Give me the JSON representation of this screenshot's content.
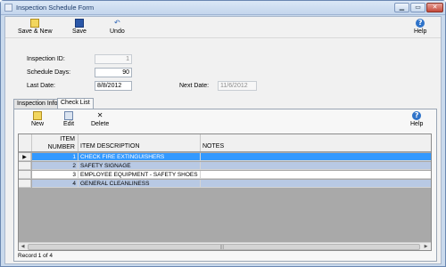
{
  "window": {
    "title": "Inspection Schedule Form",
    "controls": [
      "▁",
      "▭",
      "✕"
    ]
  },
  "toolbar": {
    "save_new": "Save & New",
    "save": "Save",
    "undo": "Undo",
    "help": "Help"
  },
  "form": {
    "inspection_id_label": "Inspection ID:",
    "inspection_id_value": "1",
    "schedule_days_label": "Schedule Days:",
    "schedule_days_value": "90",
    "last_date_label": "Last Date:",
    "last_date_value": "8/8/2012",
    "next_date_label": "Next Date:",
    "next_date_value": "11/6/2012"
  },
  "tabs": [
    "Inspection Info.",
    "Check List"
  ],
  "checklist": {
    "toolbar": {
      "new": "New",
      "edit": "Edit",
      "delete": "Delete",
      "help": "Help"
    },
    "columns": {
      "item_number_1": "ITEM",
      "item_number_2": "NUMBER",
      "description": "ITEM DESCRIPTION",
      "notes": "NOTES"
    },
    "rows": [
      {
        "number": "1",
        "description": "CHECK FIRE EXTINGUISHERS",
        "notes": ""
      },
      {
        "number": "2",
        "description": "SAFETY SIGNAGE",
        "notes": ""
      },
      {
        "number": "3",
        "description": "EMPLOYEE EQUIPMENT - SAFETY SHOES",
        "notes": ""
      },
      {
        "number": "4",
        "description": "GENERAL CLEANLINESS",
        "notes": ""
      }
    ],
    "status": "Record 1 of 4"
  },
  "colors": {
    "selected_row": "#3399ff",
    "alt_row": "#b8c9e4",
    "window_frame": "#c9d9ec"
  }
}
